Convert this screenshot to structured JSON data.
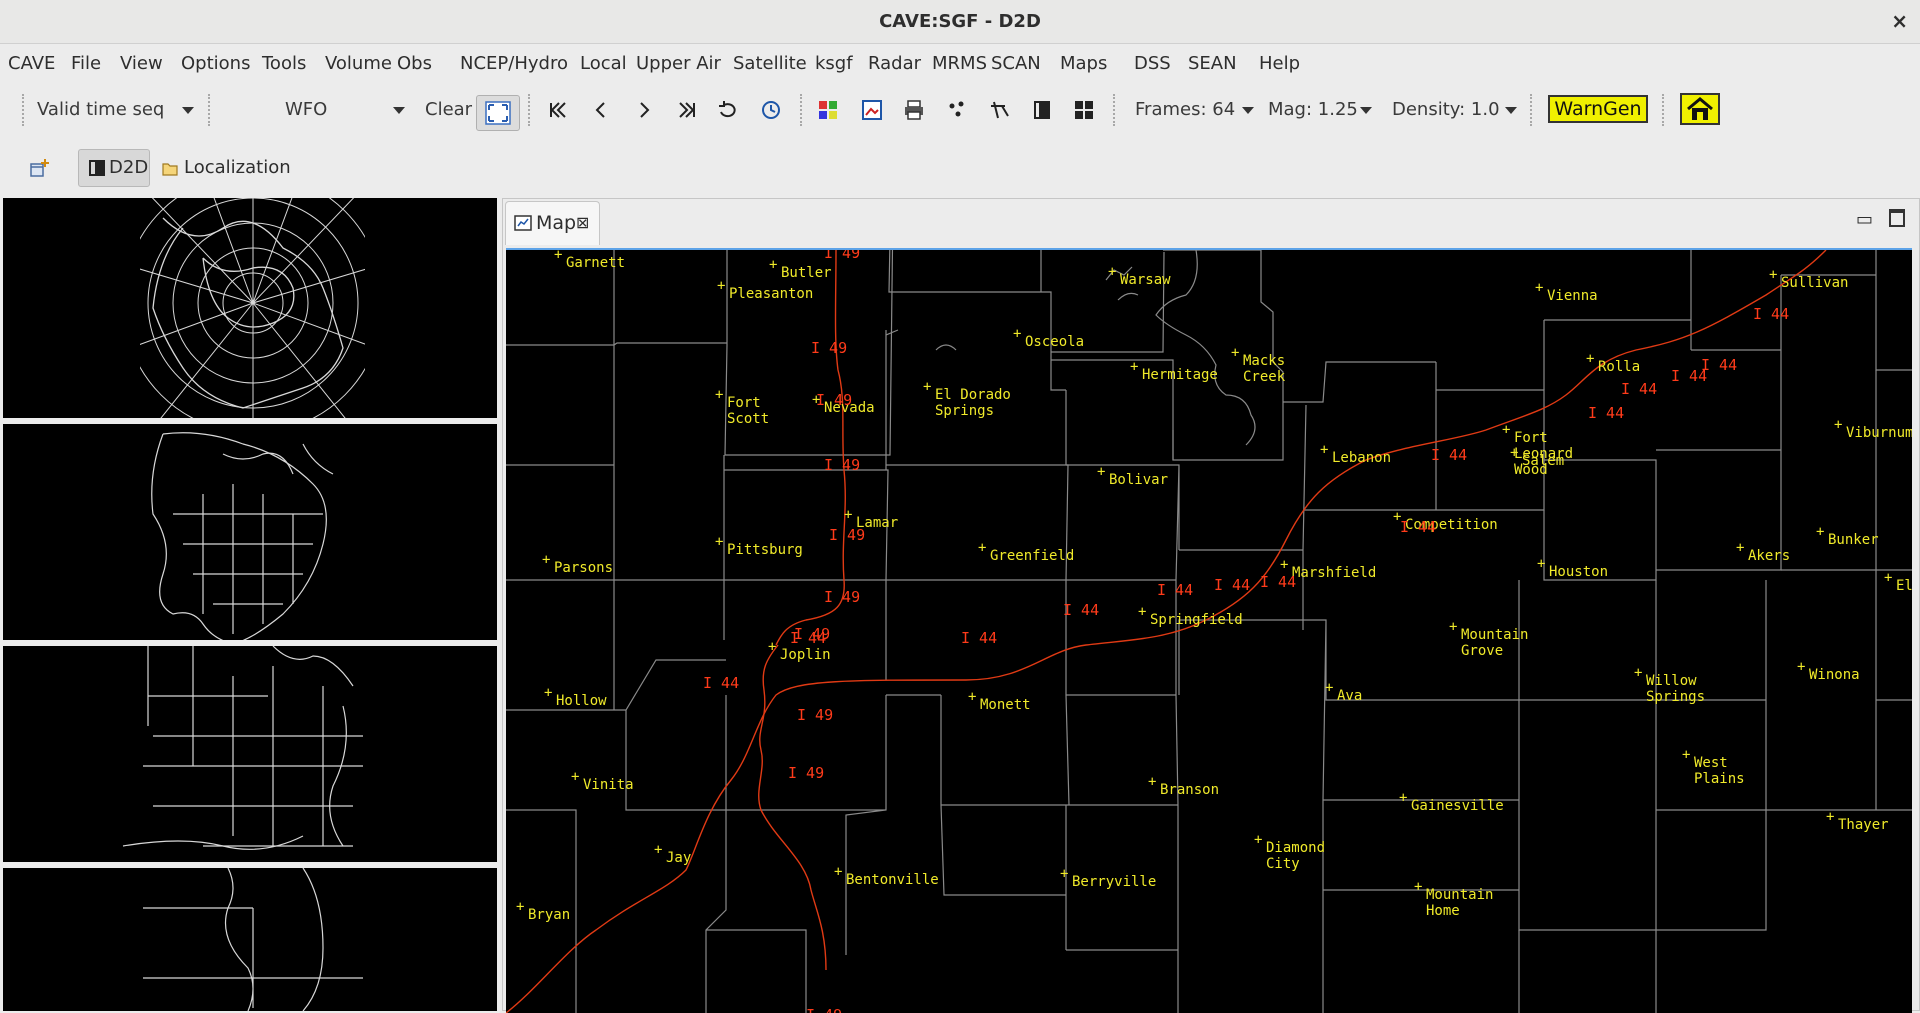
{
  "window": {
    "title": "CAVE:SGF - D2D",
    "close_glyph": "×"
  },
  "menu": [
    "CAVE",
    "File",
    "View",
    "Options",
    "Tools",
    "Volume",
    "Obs",
    "NCEP/Hydro",
    "Local",
    "Upper Air",
    "Satellite",
    "ksgf",
    "Radar",
    "MRMS",
    "SCAN",
    "Maps",
    "DSS",
    "SEAN",
    "Help"
  ],
  "toolbar": {
    "loop_mode": "Valid time seq",
    "scale": "WFO",
    "clear_label": "Clear",
    "frames_label": "Frames: 64",
    "mag_label": "Mag: 1.25",
    "density_label": "Density: 1.0",
    "warngen_label": "WarnGen"
  },
  "perspectives": {
    "d2d_label": "D2D",
    "localization_label": "Localization"
  },
  "editor": {
    "tab_label": "Map",
    "tab_close": "⊠",
    "minimize": "▭"
  },
  "map": {
    "colors": {
      "background": "#000000",
      "county_lines": "#8a8a8a",
      "interstate": "#e03a14",
      "city_labels": "#f0ea2a"
    },
    "cities": [
      {
        "name": "Garnett",
        "lines": [
          "Garnett"
        ]
      },
      {
        "name": "Butler",
        "lines": [
          "Butler"
        ]
      },
      {
        "name": "Pleasanton",
        "lines": [
          "Pleasanton"
        ]
      },
      {
        "name": "Warsaw",
        "lines": [
          "Warsaw"
        ]
      },
      {
        "name": "Vienna",
        "lines": [
          "Vienna"
        ]
      },
      {
        "name": "Sullivan",
        "lines": [
          "Sullivan"
        ]
      },
      {
        "name": "Osceola",
        "lines": [
          "Osceola"
        ]
      },
      {
        "name": "Hermitage",
        "lines": [
          "Hermitage"
        ]
      },
      {
        "name": "Macks Creek",
        "lines": [
          "Macks",
          "Creek"
        ]
      },
      {
        "name": "Rolla",
        "lines": [
          "Rolla"
        ]
      },
      {
        "name": "Fort Scott",
        "lines": [
          "Fort",
          "Scott"
        ]
      },
      {
        "name": "El Dorado Springs",
        "lines": [
          "El Dorado",
          "Springs"
        ]
      },
      {
        "name": "Nevada",
        "lines": [
          "Nevada"
        ]
      },
      {
        "name": "Fort Leonard Wood",
        "lines": [
          "Fort",
          "Leonard",
          "Wood"
        ]
      },
      {
        "name": "Viburnum",
        "lines": [
          "Viburnum"
        ]
      },
      {
        "name": "Lebanon",
        "lines": [
          "Lebanon"
        ]
      },
      {
        "name": "Salem",
        "lines": [
          "Salem"
        ]
      },
      {
        "name": "Bolivar",
        "lines": [
          "Bolivar"
        ]
      },
      {
        "name": "Competition",
        "lines": [
          "Competition"
        ]
      },
      {
        "name": "Lamar",
        "lines": [
          "Lamar"
        ]
      },
      {
        "name": "Bunker",
        "lines": [
          "Bunker"
        ]
      },
      {
        "name": "Pittsburg",
        "lines": [
          "Pittsburg"
        ]
      },
      {
        "name": "Greenfield",
        "lines": [
          "Greenfield"
        ]
      },
      {
        "name": "Akers",
        "lines": [
          "Akers"
        ]
      },
      {
        "name": "Parsons",
        "lines": [
          "Parsons"
        ]
      },
      {
        "name": "Marshfield",
        "lines": [
          "Marshfield"
        ]
      },
      {
        "name": "Houston",
        "lines": [
          "Houston"
        ]
      },
      {
        "name": "Ellington",
        "lines": [
          "Ellin"
        ]
      },
      {
        "name": "Springfield",
        "lines": [
          "Springfield"
        ]
      },
      {
        "name": "Mountain Grove",
        "lines": [
          "Mountain",
          "Grove"
        ]
      },
      {
        "name": "Joplin",
        "lines": [
          "Joplin"
        ]
      },
      {
        "name": "Winona",
        "lines": [
          "Winona"
        ]
      },
      {
        "name": "Willow Springs",
        "lines": [
          "Willow",
          "Springs"
        ]
      },
      {
        "name": "Hollow",
        "lines": [
          "Hollow"
        ]
      },
      {
        "name": "Monett",
        "lines": [
          "Monett"
        ]
      },
      {
        "name": "Ava",
        "lines": [
          "Ava"
        ]
      },
      {
        "name": "West Plains",
        "lines": [
          "West",
          "Plains"
        ]
      },
      {
        "name": "Vinita",
        "lines": [
          "Vinita"
        ]
      },
      {
        "name": "Branson",
        "lines": [
          "Branson"
        ]
      },
      {
        "name": "Gainesville",
        "lines": [
          "Gainesville"
        ]
      },
      {
        "name": "Thayer",
        "lines": [
          "Thayer"
        ]
      },
      {
        "name": "Jay",
        "lines": [
          "Jay"
        ]
      },
      {
        "name": "Diamond City",
        "lines": [
          "Diamond",
          "City"
        ]
      },
      {
        "name": "Bentonville",
        "lines": [
          "Bentonville"
        ]
      },
      {
        "name": "Berryville",
        "lines": [
          "Berryville"
        ]
      },
      {
        "name": "Mountain Home",
        "lines": [
          "Mountain",
          "Home"
        ]
      },
      {
        "name": "Bryan",
        "lines": [
          "Bryan"
        ]
      }
    ],
    "route_labels": [
      {
        "route": "I 49",
        "text": "I 49"
      },
      {
        "route": "I 44",
        "text": "I 44"
      }
    ]
  }
}
